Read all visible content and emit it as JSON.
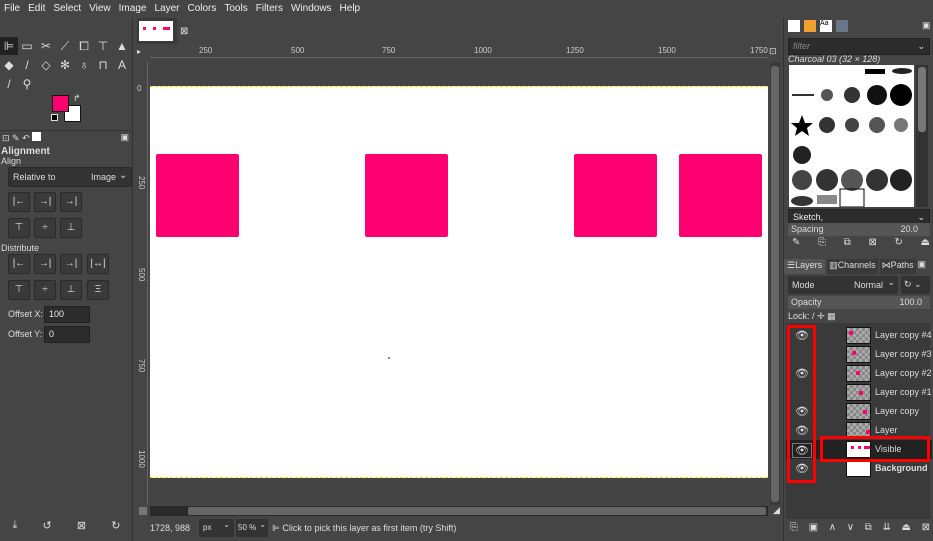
{
  "menu": [
    "File",
    "Edit",
    "Select",
    "View",
    "Image",
    "Layer",
    "Colors",
    "Tools",
    "Filters",
    "Windows",
    "Help"
  ],
  "colors": {
    "foreground": "#ff0070",
    "background": "#ffffff",
    "highlight": "#ff0000"
  },
  "tool_options": {
    "title": "Alignment",
    "align_label": "Align",
    "relative_to_label": "Relative to",
    "relative_to_value": "Image",
    "distribute_label": "Distribute",
    "offset_x_label": "Offset X:",
    "offset_x_value": "100",
    "offset_y_label": "Offset Y:",
    "offset_y_value": "0"
  },
  "rulers": {
    "top": [
      "250",
      "500",
      "750",
      "1000",
      "1250",
      "1500",
      "1750"
    ],
    "left": [
      "0",
      "250",
      "500",
      "750",
      "1000"
    ]
  },
  "status": {
    "coords": "1728, 988",
    "unit": "px",
    "zoom": "50 %",
    "message": "Click to pick this layer as first item (try Shift)"
  },
  "brushes": {
    "filter_placeholder": "filter",
    "current": "Charcoal 03 (32 × 128)",
    "tag": "Sketch,",
    "spacing_label": "Spacing",
    "spacing_value": "20.0"
  },
  "layers_panel": {
    "tabs": [
      "Layers",
      "Channels",
      "Paths"
    ],
    "mode_label": "Mode",
    "mode_value": "Normal",
    "opacity_label": "Opacity",
    "opacity_value": "100.0",
    "lock_label": "Lock:",
    "layers": [
      {
        "name": "Layer copy #4",
        "visible": true
      },
      {
        "name": "Layer copy #3",
        "visible": false
      },
      {
        "name": "Layer copy #2",
        "visible": true
      },
      {
        "name": "Layer copy #1",
        "visible": false
      },
      {
        "name": "Layer copy",
        "visible": true
      },
      {
        "name": "Layer",
        "visible": true
      },
      {
        "name": "Visible",
        "visible": true,
        "selected": true
      },
      {
        "name": "Background",
        "visible": true
      }
    ]
  }
}
